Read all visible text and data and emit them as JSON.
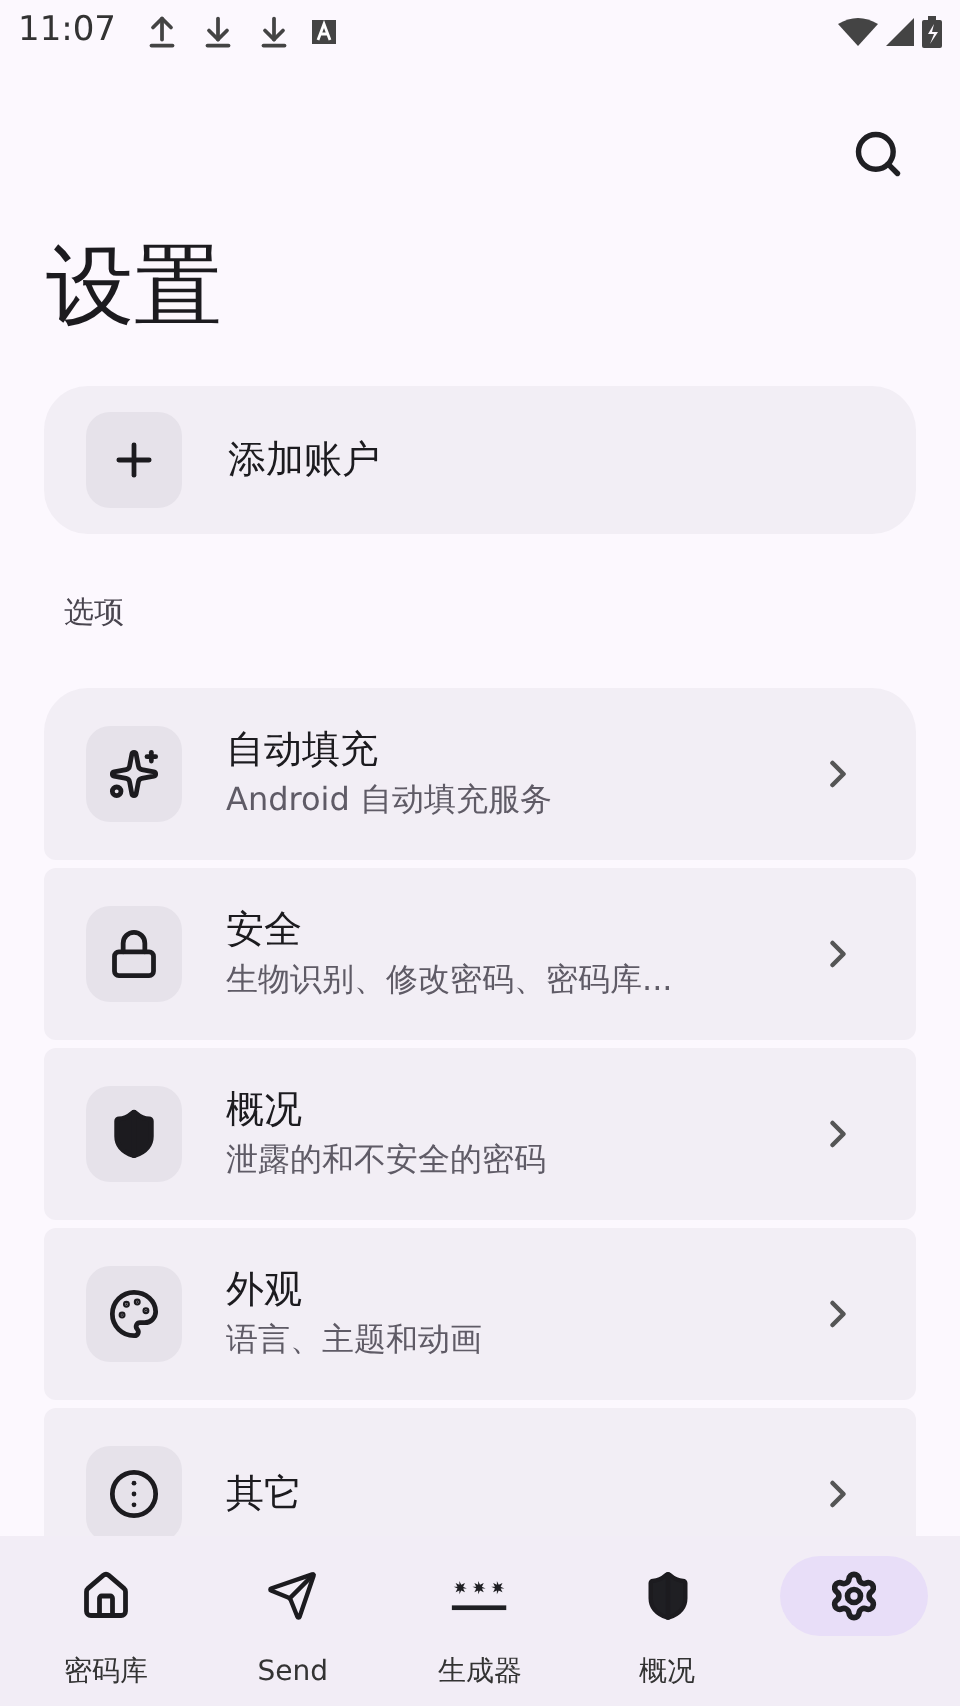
{
  "status_bar": {
    "time": "11:07"
  },
  "title": "设置",
  "add_account": {
    "label": "添加账户"
  },
  "section": "选项",
  "options": [
    {
      "title": "自动填充",
      "subtitle": "Android 自动填充服务"
    },
    {
      "title": "安全",
      "subtitle": "生物识别、修改密码、密码库..."
    },
    {
      "title": "概况",
      "subtitle": "泄露的和不安全的密码"
    },
    {
      "title": "外观",
      "subtitle": "语言、主题和动画"
    },
    {
      "title": "其它"
    }
  ],
  "nav": [
    {
      "label": "密码库",
      "selected": false
    },
    {
      "label": "Send",
      "selected": false
    },
    {
      "label": "生成器",
      "selected": false
    },
    {
      "label": "概况",
      "selected": false
    },
    {
      "selected": true
    }
  ]
}
